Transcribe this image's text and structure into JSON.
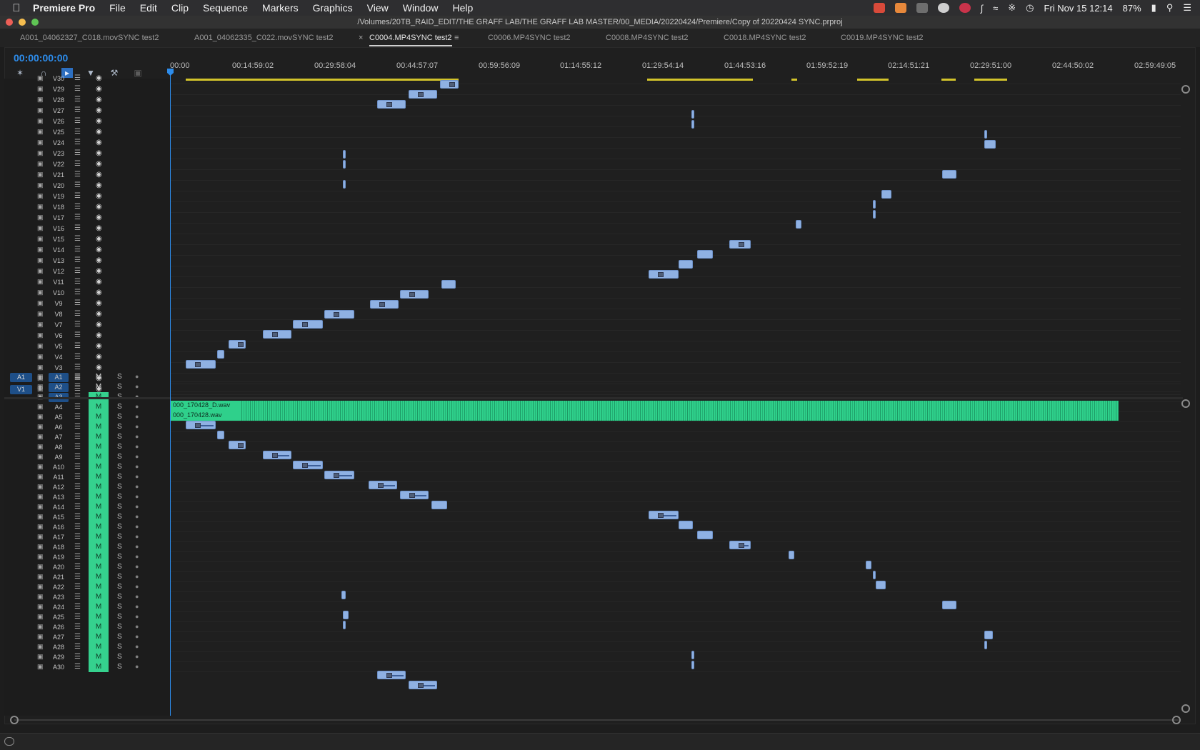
{
  "menubar": {
    "app": "Premiere Pro",
    "menus": [
      "File",
      "Edit",
      "Clip",
      "Sequence",
      "Markers",
      "Graphics",
      "View",
      "Window",
      "Help"
    ],
    "clock": "Fri Nov 15  12:14",
    "battery": "87%"
  },
  "window": {
    "title": "/Volumes/20TB_RAID_EDIT/THE GRAFF LAB/THE GRAFF LAB MASTER/00_MEDIA/20220424/Premiere/Copy of 20220424 SYNC.prproj"
  },
  "tabs": [
    "A001_04062327_C018.movSYNC test2",
    "A001_04062335_C022.movSYNC test2",
    "C0004.MP4SYNC test2",
    "C0006.MP4SYNC test2",
    "C0008.MP4SYNC test2",
    "C0018.MP4SYNC test2",
    "C0019.MP4SYNC test2"
  ],
  "active_tab": "C0004.MP4SYNC test2",
  "timecode": "00:00:00:00",
  "ruler": [
    "00:00",
    "00:14:59:02",
    "00:29:58:04",
    "00:44:57:07",
    "00:59:56:09",
    "01:14:55:12",
    "01:29:54:14",
    "01:44:53:16",
    "01:59:52:19",
    "02:14:51:21",
    "02:29:51:00",
    "02:44:50:02",
    "02:59:49:05"
  ],
  "video_tracks": [
    "V30",
    "V29",
    "V28",
    "V27",
    "V26",
    "V25",
    "V24",
    "V23",
    "V22",
    "V21",
    "V20",
    "V19",
    "V18",
    "V17",
    "V16",
    "V15",
    "V14",
    "V13",
    "V12",
    "V11",
    "V10",
    "V9",
    "V8",
    "V7",
    "V6",
    "V5",
    "V4",
    "V3",
    "V2",
    "V1"
  ],
  "audio_tracks": [
    "A1",
    "A2",
    "A3",
    "A4",
    "A5",
    "A6",
    "A7",
    "A8",
    "A9",
    "A10",
    "A11",
    "A12",
    "A13",
    "A14",
    "A15",
    "A16",
    "A17",
    "A18",
    "A19",
    "A20",
    "A21",
    "A22",
    "A23",
    "A24",
    "A25",
    "A26",
    "A27",
    "A28",
    "A29",
    "A30"
  ],
  "source_patch": {
    "video": "V1",
    "audio": "A1"
  },
  "mute_label": "M",
  "solo_label": "S",
  "audio_clips": {
    "a1": "000_170428_D.wav",
    "a2": "000_170428.wav"
  },
  "colors": {
    "accent": "#2d8ceb",
    "video_clip": "#8fb1e3",
    "audio_wave": "#2fd08b",
    "mute_on": "#35d18e",
    "in_out_bar": "#d3c42b"
  }
}
